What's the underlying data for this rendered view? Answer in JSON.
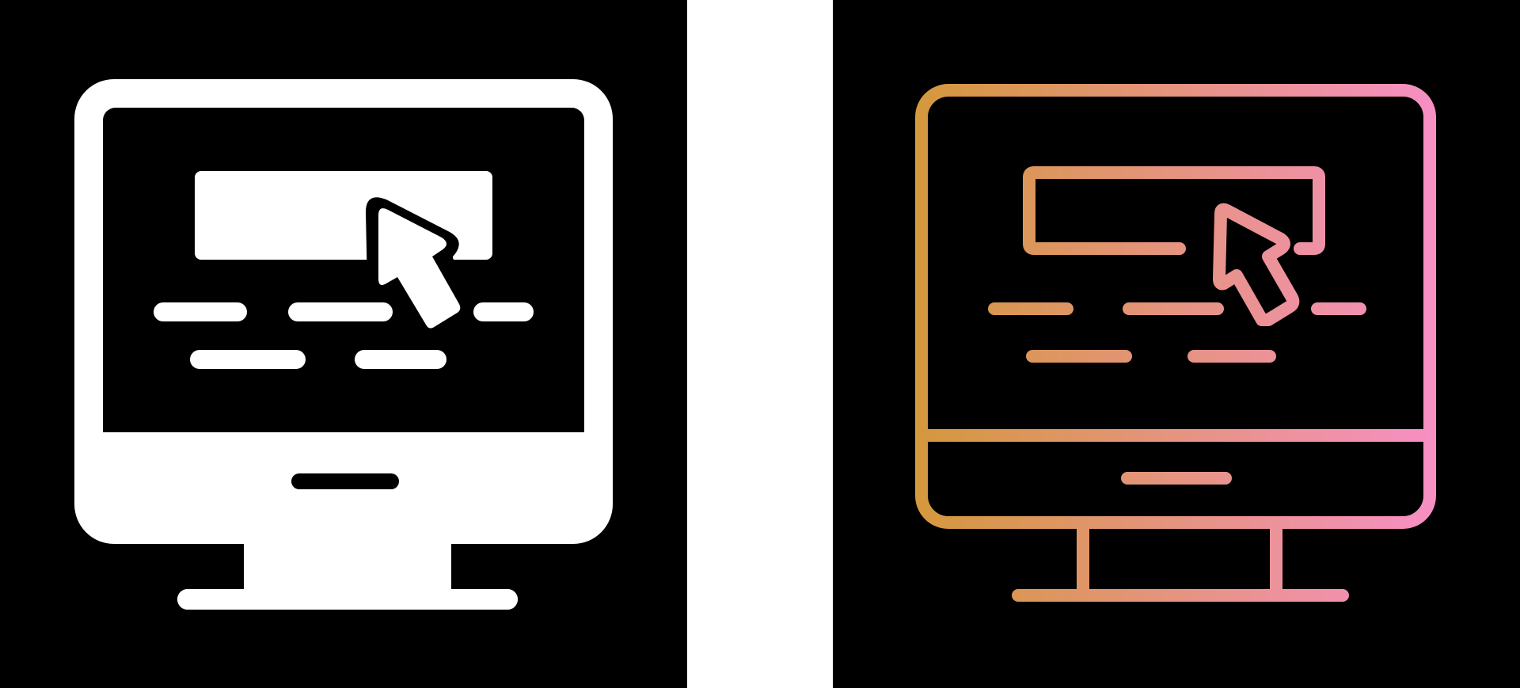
{
  "icons": [
    {
      "variant": "glyph",
      "icon": "monitor-click-icon",
      "background": "#000000",
      "color": "#ffffff"
    },
    {
      "variant": "gradient-outline",
      "icon": "monitor-click-icon",
      "background": "#000000",
      "gradient_start": "#d4983c",
      "gradient_end": "#f78fc4"
    }
  ],
  "divider_color": "#ffffff"
}
